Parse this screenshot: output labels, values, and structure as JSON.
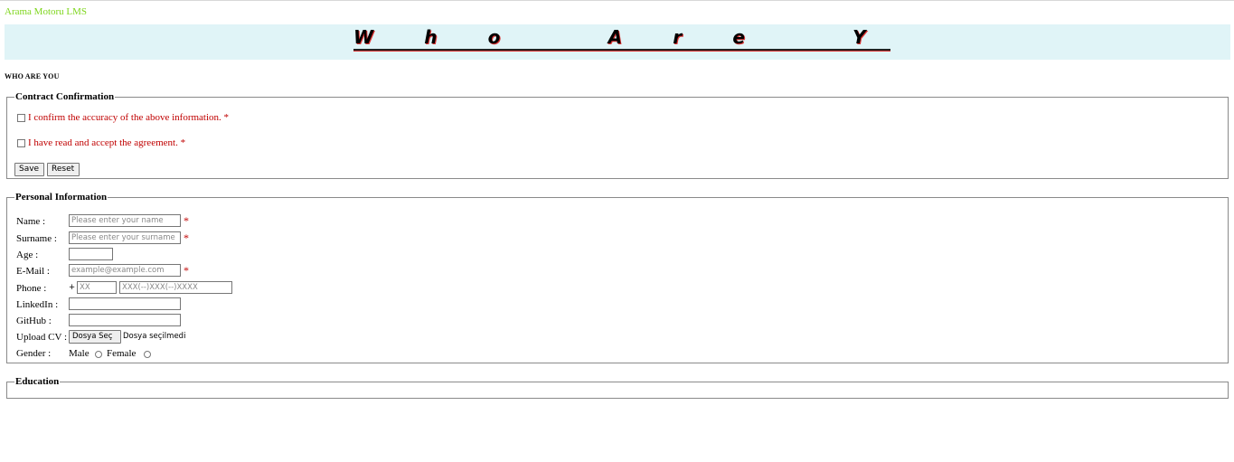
{
  "brand": "Arama Motoru LMS",
  "banner_title": "W h o   A r e   Y o u   ?",
  "subheading": "WHO ARE YOU",
  "contract": {
    "legend": "Contract Confirmation",
    "confirm_accuracy": "I confirm the accuracy of the above information. *",
    "accept_agreement": "I have read and accept the agreement. *",
    "save_label": "Save",
    "reset_label": "Reset"
  },
  "personal": {
    "legend": "Personal Information",
    "name_label": "Name :",
    "name_placeholder": "Please enter your name",
    "surname_label": "Surname :",
    "surname_placeholder": "Please enter your surname",
    "age_label": "Age :",
    "email_label": "E-Mail :",
    "email_placeholder": "example@example.com",
    "phone_label": "Phone :",
    "phone_plus": "+",
    "phone_code_placeholder": "XX",
    "phone_number_placeholder": "XXX(--)XXX(--)XXXX",
    "linkedin_label": "LinkedIn :",
    "github_label": "GitHub :",
    "upload_label": "Upload CV :",
    "file_button": "Dosya Seç",
    "file_status": "Dosya seçilmedi",
    "gender_label": "Gender :",
    "male_label": "Male",
    "female_label": "Female",
    "required_mark": "*"
  },
  "education": {
    "legend": "Education"
  },
  "colors": {
    "brand": "#7fd61e",
    "banner_bg": "#e0f4f7",
    "required": "#c00000"
  }
}
